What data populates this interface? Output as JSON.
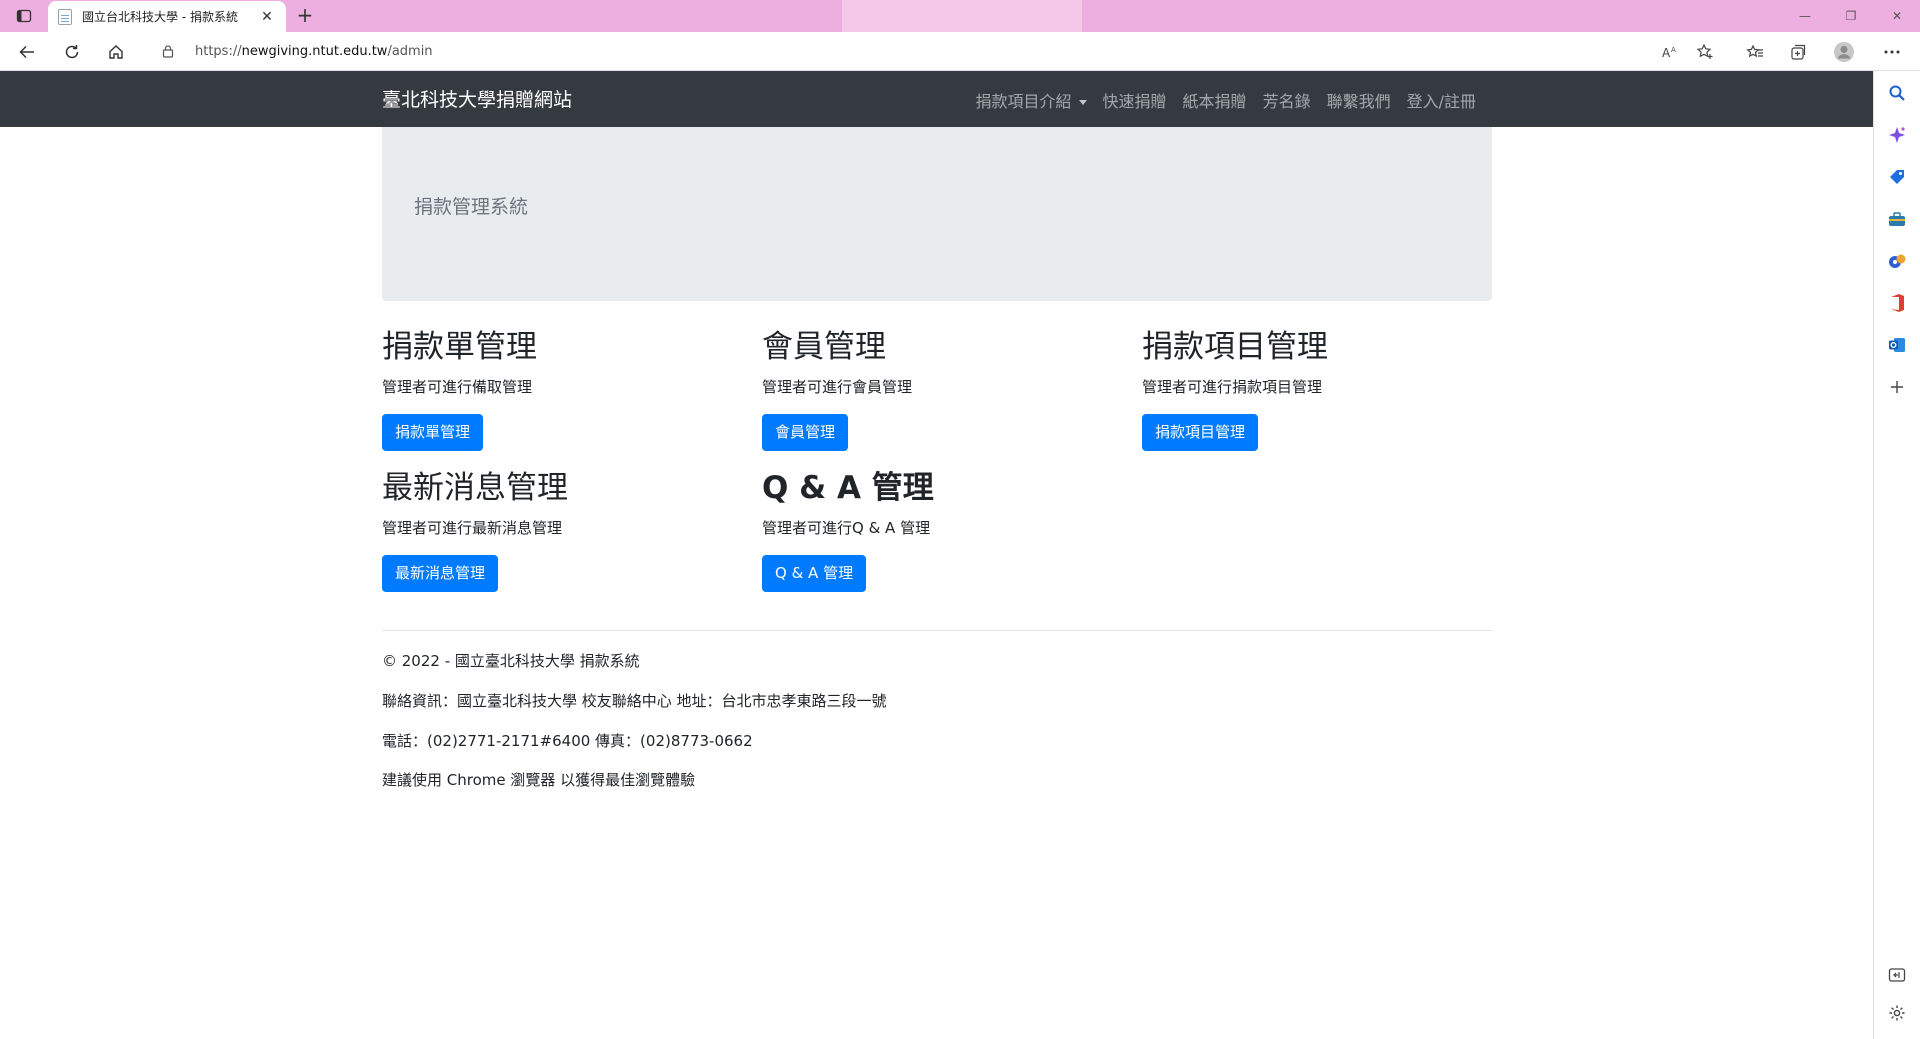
{
  "browser": {
    "tab_title": "國立台北科技大學 - 捐款系統",
    "tab_close": "✕",
    "new_tab": "+",
    "url_prefix": "https://",
    "url_host": "newgiving.ntut.edu.tw",
    "url_path": "/admin",
    "window_controls": {
      "minimize": "—",
      "restore": "❐",
      "close": "✕"
    }
  },
  "navbar": {
    "brand": "臺北科技大學捐贈網站",
    "links": [
      {
        "label": "捐款項目介紹",
        "dropdown": true
      },
      {
        "label": "快速捐贈"
      },
      {
        "label": "紙本捐贈"
      },
      {
        "label": "芳名錄"
      },
      {
        "label": "聯繫我們"
      },
      {
        "label": "登入/註冊"
      }
    ]
  },
  "jumbotron": {
    "text": "捐款管理系統"
  },
  "sections": [
    {
      "title": "捐款單管理",
      "desc": "管理者可進行備取管理",
      "button": "捐款單管理"
    },
    {
      "title": "會員管理",
      "desc": "管理者可進行會員管理",
      "button": "會員管理"
    },
    {
      "title": "捐款項目管理",
      "desc": "管理者可進行捐款項目管理",
      "button": "捐款項目管理"
    },
    {
      "title": "最新消息管理",
      "desc": "管理者可進行最新消息管理",
      "button": "最新消息管理"
    },
    {
      "title": "Q & A 管理",
      "desc": "管理者可進行Q & A 管理",
      "button": "Q & A 管理"
    }
  ],
  "footer": {
    "copyright": "© 2022 - 國立臺北科技大學 捐款系統",
    "contact": "聯絡資訊：國立臺北科技大學 校友聯絡中心 地址：台北市忠孝東路三段一號",
    "phone": "電話：(02)2771-2171#6400 傳真：(02)8773-0662",
    "browser_tip": "建議使用 Chrome 瀏覽器 以獲得最佳瀏覽體驗"
  },
  "colors": {
    "titlebar": "#ecafdf",
    "navbar": "#343a40",
    "jumbotron": "#e9ecef",
    "primary_button": "#007bff"
  },
  "icons": {
    "toolbar": [
      "tab-actions-icon",
      "back-icon",
      "refresh-icon",
      "home-icon",
      "lock-icon",
      "read-aloud-icon",
      "add-favorite-icon",
      "favorites-icon",
      "collections-icon",
      "profile-avatar-icon",
      "more-icon"
    ],
    "sidebar": [
      "search-icon",
      "copilot-icon",
      "shopping-tag-icon",
      "tools-icon",
      "games-icon",
      "office-icon",
      "outlook-icon",
      "add-icon",
      "hide-sidebar-icon",
      "settings-icon"
    ]
  }
}
